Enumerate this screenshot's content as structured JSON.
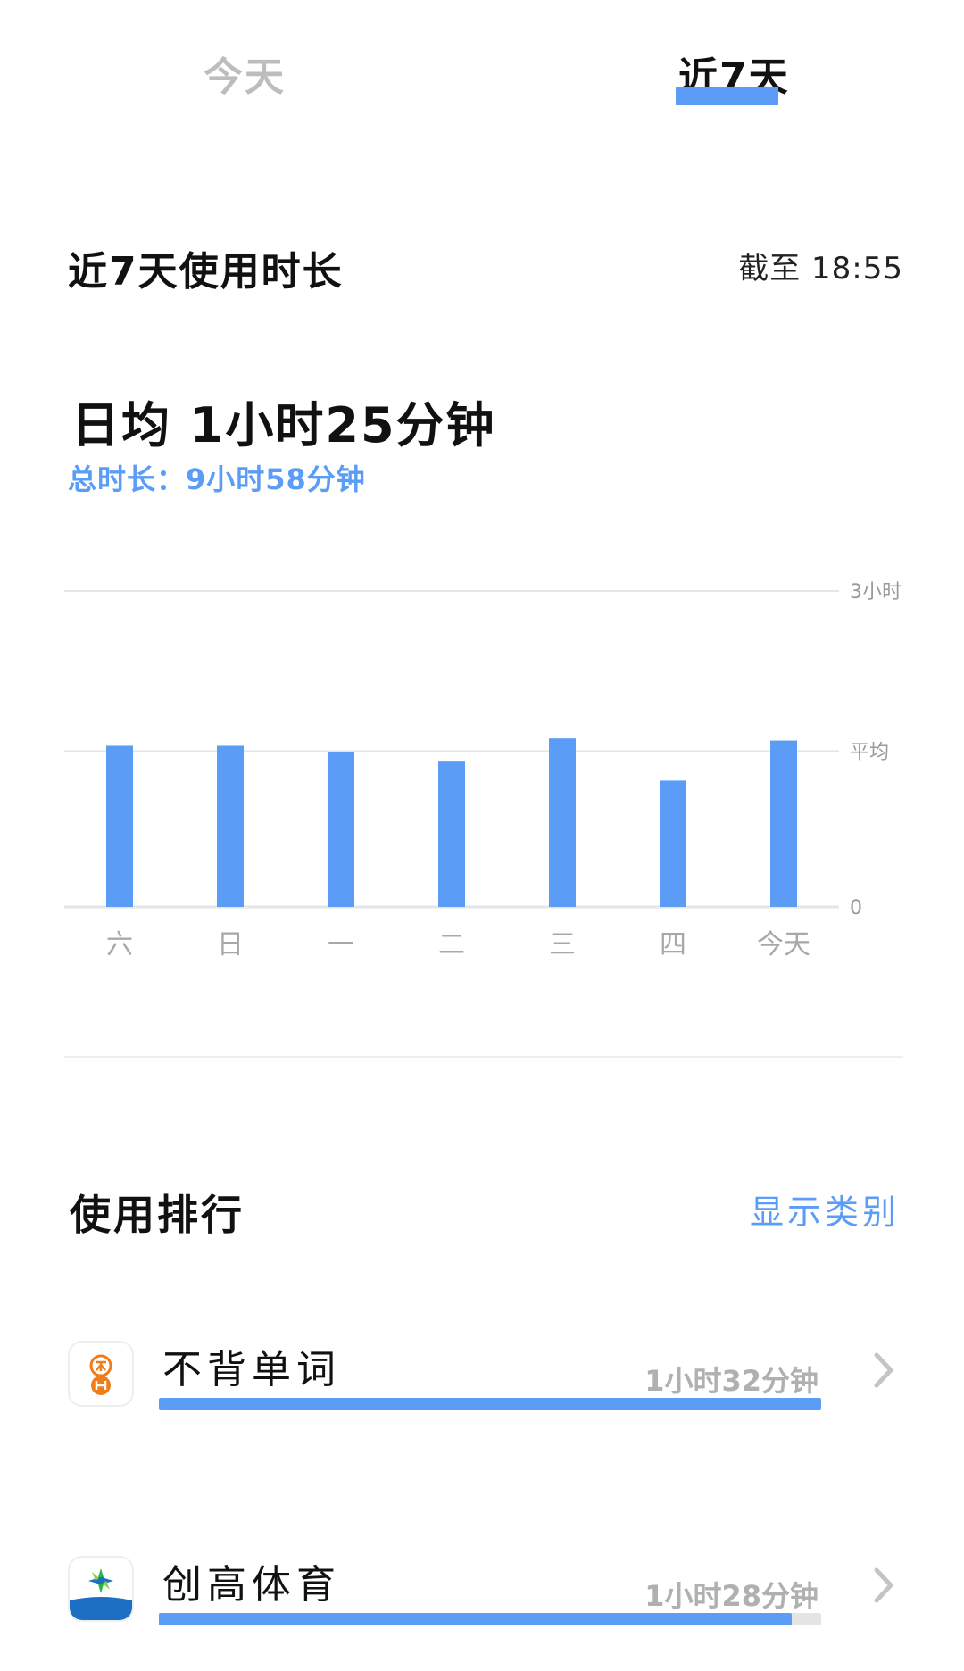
{
  "tabs": [
    {
      "label": "今天",
      "active": false
    },
    {
      "label": "近7天",
      "active": true
    }
  ],
  "header": {
    "title": "近7天使用时长",
    "as_of": "截至 18:55"
  },
  "summary": {
    "daily_avg": "日均 1小时25分钟",
    "total": "总时长：9小时58分钟"
  },
  "chart_data": {
    "type": "bar",
    "categories": [
      "六",
      "日",
      "一",
      "二",
      "三",
      "四",
      "今天"
    ],
    "values": [
      1.53,
      1.53,
      1.47,
      1.38,
      1.6,
      1.2,
      1.58
    ],
    "y_unit": "hours",
    "ylim": [
      0,
      3
    ],
    "y_tick_labels": [
      {
        "value": 3,
        "label": "3小时"
      },
      {
        "value": 1.48,
        "label": "平均"
      },
      {
        "value": 0,
        "label": "0"
      }
    ],
    "bar_color": "#5b9cf6",
    "grid": true
  },
  "ranking": {
    "title": "使用排行",
    "show_category": "显示类别",
    "apps": [
      {
        "name": "不背单词",
        "time": "1小时32分钟",
        "fraction": 1.0,
        "icon": "bubei-icon"
      },
      {
        "name": "创高体育",
        "time": "1小时28分钟",
        "fraction": 0.955,
        "icon": "chuanggao-icon"
      }
    ]
  },
  "colors": {
    "accent": "#5b9cf6",
    "muted": "#bdbdbd"
  }
}
